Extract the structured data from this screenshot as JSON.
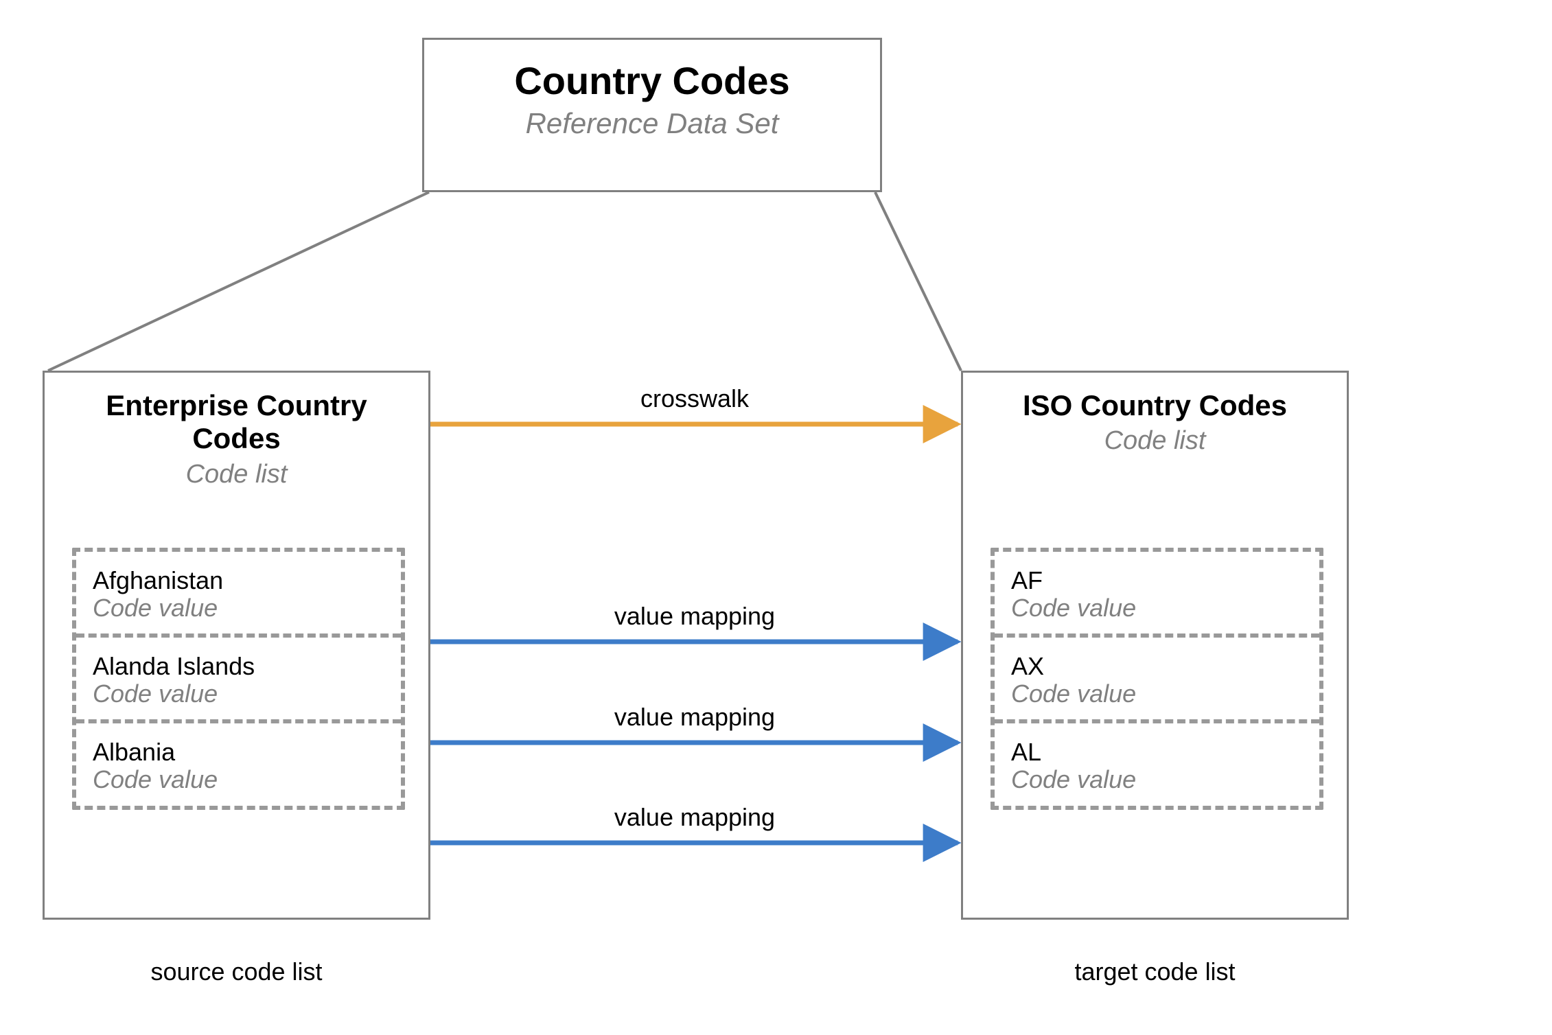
{
  "topBox": {
    "title": "Country Codes",
    "subtitle": "Reference Data Set"
  },
  "leftBox": {
    "title": "Enterprise Country Codes",
    "subtitle": "Code list",
    "values": [
      {
        "name": "Afghanistan",
        "kind": "Code value"
      },
      {
        "name": "Alanda Islands",
        "kind": "Code value"
      },
      {
        "name": "Albania",
        "kind": "Code value"
      }
    ],
    "caption": "source code list"
  },
  "rightBox": {
    "title": "ISO Country Codes",
    "subtitle": "Code list",
    "values": [
      {
        "name": "AF",
        "kind": "Code value"
      },
      {
        "name": "AX",
        "kind": "Code value"
      },
      {
        "name": "AL",
        "kind": "Code value"
      }
    ],
    "caption": "target code list"
  },
  "labels": {
    "crosswalk": "crosswalk",
    "valueMapping": "value mapping"
  },
  "colors": {
    "crosswalkArrow": "#e8a33d",
    "valueArrow": "#3d7cc9"
  }
}
